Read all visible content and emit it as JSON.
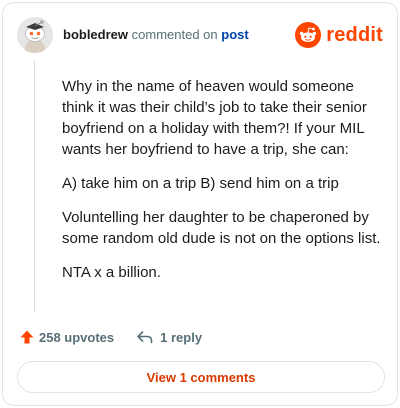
{
  "comment": {
    "author": "bobledrew",
    "action_text": "commented on",
    "post_link_text": "post",
    "paragraphs": [
      "Why in the name of heaven would someone think it was their child’s job to take their senior boyfriend on a holiday with them?! If your MIL wants her boyfriend to have a trip, she can:",
      "A) take him on a trip B) send him on a trip",
      "Voluntelling her daughter to be chaperoned by some random old dude is not on the options list.",
      "NTA x a billion."
    ]
  },
  "brand": {
    "wordmark": "reddit",
    "color": "#ff4500"
  },
  "actions": {
    "upvotes_label": "258 upvotes",
    "reply_label": "1 reply"
  },
  "view_comments_label": "View 1 comments",
  "icons": {
    "avatar": "snoo-avatar-icon",
    "logo": "reddit-logo-icon",
    "upvote": "upvote-arrow-icon",
    "reply": "reply-arrow-icon"
  }
}
